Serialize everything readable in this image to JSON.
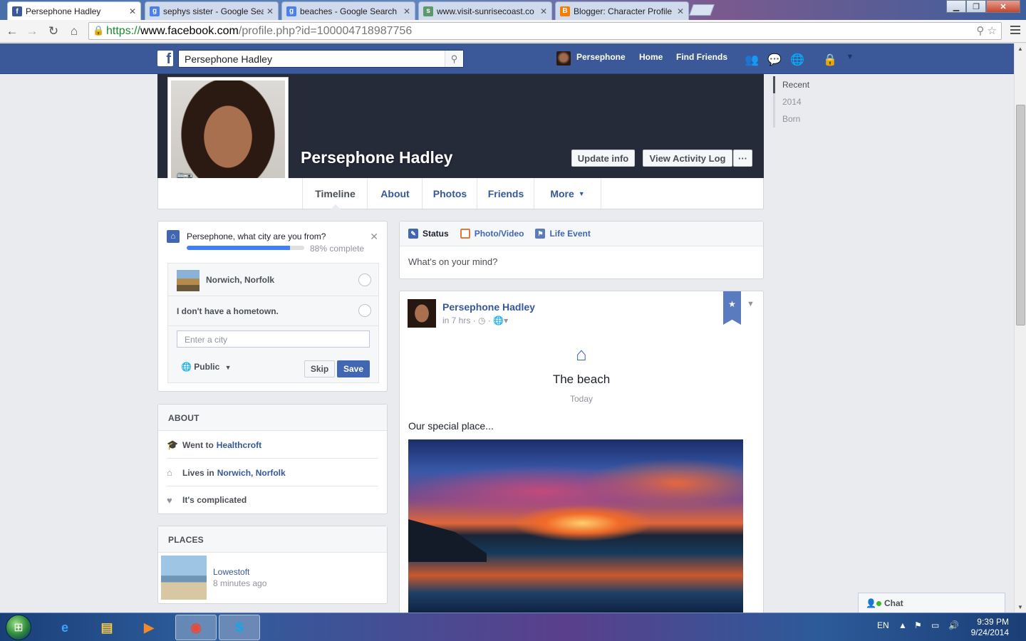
{
  "browser": {
    "tabs": [
      {
        "title": "Persephone Hadley",
        "icon": "facebook-favicon",
        "active": true
      },
      {
        "title": "sephys sister - Google Sea",
        "icon": "google-favicon",
        "active": false
      },
      {
        "title": "beaches - Google Search",
        "icon": "google-favicon",
        "active": false
      },
      {
        "title": "www.visit-sunrisecoast.co",
        "icon": "site-favicon",
        "active": false
      },
      {
        "title": "Blogger: Character Profile",
        "icon": "blogger-favicon",
        "active": false
      }
    ],
    "address": {
      "scheme": "https://",
      "host": "www.facebook.com",
      "path": "/profile.php?id=100004718987756"
    }
  },
  "fb_header": {
    "search_value": "Persephone Hadley",
    "user_name": "Persephone",
    "nav": [
      "Home",
      "Find Friends"
    ]
  },
  "profile": {
    "name": "Persephone Hadley",
    "buttons": {
      "update_info": "Update info",
      "activity_log": "View Activity Log",
      "more": "···"
    },
    "tabs": [
      "Timeline",
      "About",
      "Photos",
      "Friends",
      "More"
    ],
    "active_tab": "Timeline"
  },
  "timeline_rail": [
    "Recent",
    "2014",
    "Born"
  ],
  "hometown_prompt": {
    "question": "Persephone, what city are you from?",
    "progress_percent": 88,
    "progress_text": "88% complete",
    "options": [
      "Norwich, Norfolk",
      "I don't have a hometown."
    ],
    "city_placeholder": "Enter a city",
    "privacy": "Public",
    "skip_label": "Skip",
    "save_label": "Save"
  },
  "about": {
    "header": "ABOUT",
    "rows": [
      {
        "prefix": "Went to",
        "link": "Healthcroft",
        "icon": "school-icon"
      },
      {
        "prefix": "Lives in",
        "link": "Norwich, Norfolk",
        "icon": "home-icon"
      },
      {
        "prefix": "It's complicated",
        "link": "",
        "icon": "heart-icon"
      }
    ]
  },
  "places": {
    "header": "PLACES",
    "items": [
      {
        "name": "Lowestoft",
        "time": "8 minutes ago"
      }
    ]
  },
  "composer": {
    "tabs": [
      "Status",
      "Photo/Video",
      "Life Event"
    ],
    "placeholder": "What's on your mind?"
  },
  "post": {
    "author": "Persephone Hadley",
    "meta": "in 7 hrs · ◷ · ",
    "life_event_title": "The beach",
    "life_event_date": "Today",
    "text": "Our special place..."
  },
  "chat": {
    "label": "Chat"
  },
  "taskbar": {
    "lang": "EN",
    "time": "9:39 PM",
    "date": "9/24/2014"
  },
  "colors": {
    "facebook_blue": "#3b5998",
    "link_blue": "#365899",
    "cover_dark": "#262b3a"
  }
}
